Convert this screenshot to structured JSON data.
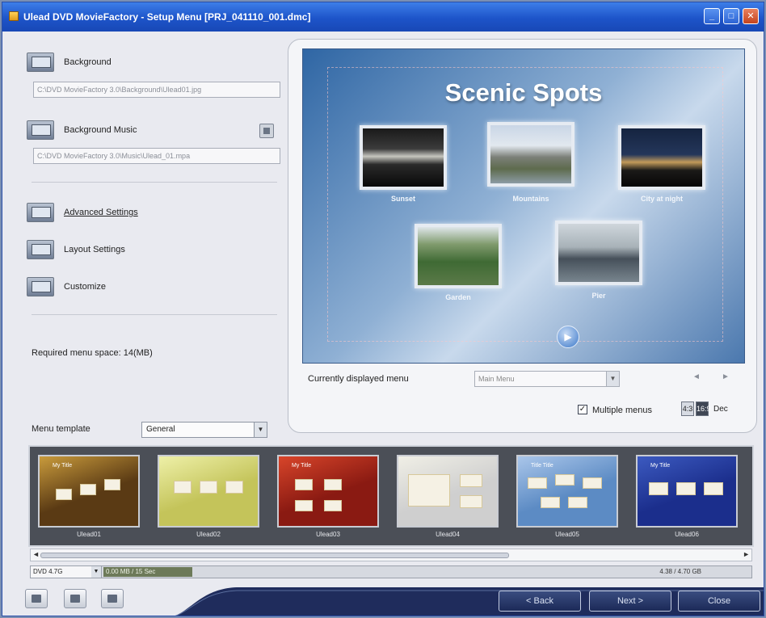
{
  "window": {
    "title": "Ulead DVD MovieFactory - Setup Menu [PRJ_041110_001.dmc]",
    "min_glyph": "_",
    "max_glyph": "□",
    "close_glyph": "✕"
  },
  "left_panel": {
    "background_label": "Background",
    "background_path": "C:\\DVD MovieFactory 3.0\\Background\\Ulead01.jpg",
    "bg_music_label": "Background Music",
    "bg_music_path": "C:\\DVD MovieFactory 3.0\\Music\\Ulead_01.mpa",
    "advanced_label": "Advanced Settings",
    "layout_label": "Layout Settings",
    "customize_label": "Customize",
    "required_space": "Required menu space: 14(MB)"
  },
  "preview": {
    "menu_title": "Scenic Spots",
    "thumbnails": [
      {
        "caption": "Sunset"
      },
      {
        "caption": "Mountains"
      },
      {
        "caption": "City at night"
      },
      {
        "caption": "Garden"
      },
      {
        "caption": "Pier"
      }
    ],
    "next_glyph": "▶"
  },
  "current_menu": {
    "label": "Currently displayed menu",
    "value": "Main Menu",
    "prev_glyph": "◄",
    "next_glyph": "►"
  },
  "multiplex": {
    "checked_glyph": "✓",
    "label": "Multiple menus"
  },
  "aspect": {
    "opt_a": "4:3",
    "opt_b": "16:9",
    "label": "Dec"
  },
  "template": {
    "label": "Menu template",
    "selected": "General",
    "dropdown_glyph": "▼",
    "items": [
      {
        "caption": "Ulead01",
        "bg": "#5a3a14",
        "accent": "#c99b3c",
        "title": "My Title"
      },
      {
        "caption": "Ulead02",
        "bg": "#c4c45a",
        "accent": "#eef0a8",
        "title": ""
      },
      {
        "caption": "Ulead03",
        "bg": "#8a1a12",
        "accent": "#d8452a",
        "title": "My Title"
      },
      {
        "caption": "Ulead04",
        "bg": "#cfcfcf",
        "accent": "#f0efe6",
        "title": ""
      },
      {
        "caption": "Ulead05",
        "bg": "#5c8bc4",
        "accent": "#aac6ea",
        "title": "Title Title"
      },
      {
        "caption": "Ulead06",
        "bg": "#1b2e8c",
        "accent": "#3c5ac0",
        "title": "My Title"
      }
    ]
  },
  "scroll": {
    "left_glyph": "◄",
    "right_glyph": "►"
  },
  "status": {
    "disc_type": "DVD 4.7G",
    "usage": "0.00 MB / 15 Sec",
    "remaining": "4.38 / 4.70 GB"
  },
  "footer": {
    "back_label": "< Back",
    "next_label": "Next >",
    "close_label": "Close"
  }
}
